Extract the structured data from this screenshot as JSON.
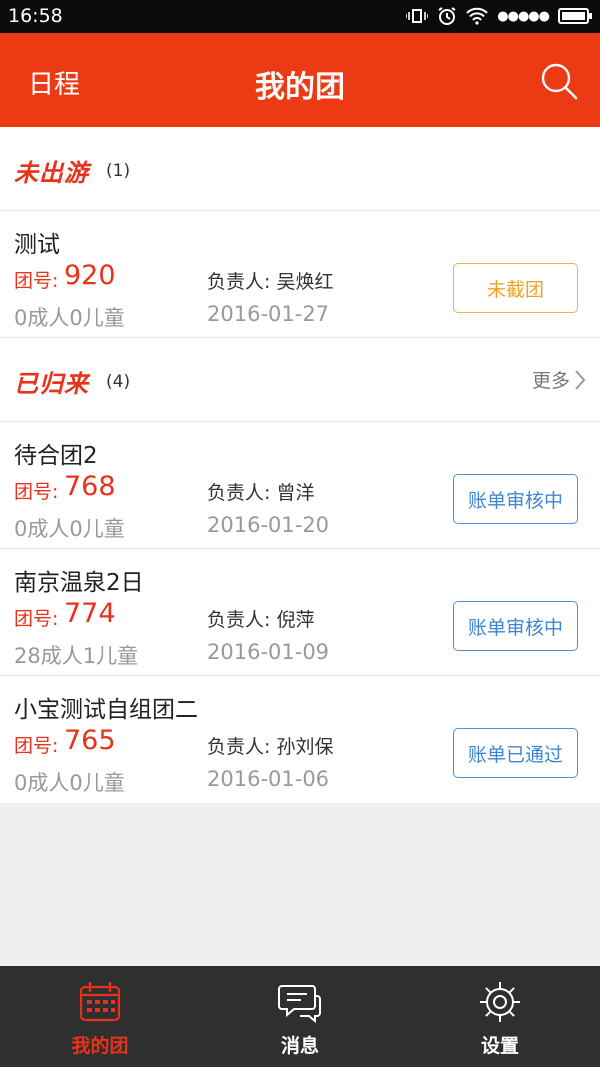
{
  "statusbar": {
    "time": "16:58",
    "signal_dots": "●●●●●"
  },
  "appbar": {
    "left_label": "日程",
    "title": "我的团"
  },
  "sections": [
    {
      "title": "未出游",
      "count": "(1)",
      "more": "",
      "items": [
        {
          "name": "测试",
          "team_label": "团号:",
          "team_no": "920",
          "leader": "负责人: 吴焕红",
          "pax": "0成人0儿童",
          "date": "2016-01-27",
          "status": "未截团"
        }
      ]
    },
    {
      "title": "已归来",
      "count": "(4)",
      "more": "更多",
      "items": [
        {
          "name": "待合团2",
          "team_label": "团号:",
          "team_no": "768",
          "leader": "负责人: 曾洋",
          "pax": "0成人0儿童",
          "date": "2016-01-20",
          "status": "账单审核中"
        },
        {
          "name": "南京温泉2日",
          "team_label": "团号:",
          "team_no": "774",
          "leader": "负责人: 倪萍",
          "pax": "28成人1儿童",
          "date": "2016-01-09",
          "status": "账单审核中"
        },
        {
          "name": "小宝测试自组团二",
          "team_label": "团号:",
          "team_no": "765",
          "leader": "负责人: 孙刘保",
          "pax": "0成人0儿童",
          "date": "2016-01-06",
          "status": "账单已通过"
        }
      ]
    }
  ],
  "tabbar": {
    "tabs": [
      {
        "label": "我的团",
        "icon": "calendar-icon",
        "active": true
      },
      {
        "label": "消息",
        "icon": "chat-icon",
        "active": false
      },
      {
        "label": "设置",
        "icon": "gear-icon",
        "active": false
      }
    ]
  },
  "colors": {
    "brand_red": "#eb3a14",
    "pending_orange": "#f0a320",
    "review_blue": "#3f86d2",
    "tabbar_bg": "#2f2f2f"
  }
}
